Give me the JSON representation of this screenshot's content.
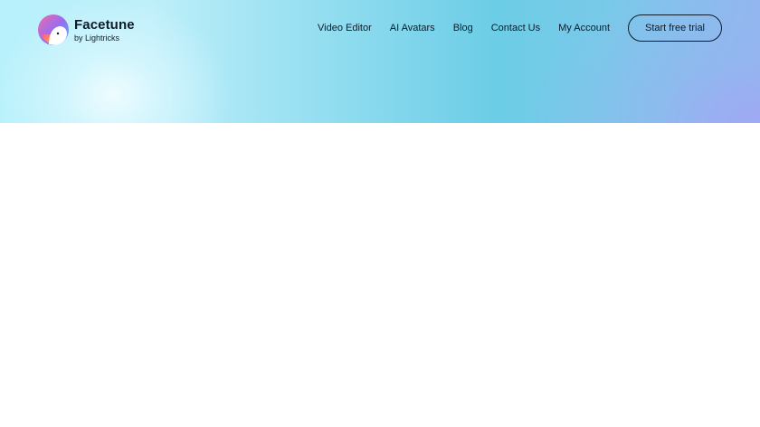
{
  "logo": {
    "name": "Facetune",
    "subtitle": "by Lightricks",
    "icon": "facetune-logo-icon"
  },
  "nav": {
    "items": [
      {
        "label": "Video Editor"
      },
      {
        "label": "AI Avatars"
      },
      {
        "label": "Blog"
      },
      {
        "label": "Contact Us"
      },
      {
        "label": "My Account"
      }
    ],
    "cta_label": "Start free trial"
  },
  "colors": {
    "text": "#0d1b2a",
    "hero_left": "#b8f1fb",
    "hero_mid": "#6ccde6",
    "hero_right": "#93b6f0",
    "background": "#ffffff"
  }
}
